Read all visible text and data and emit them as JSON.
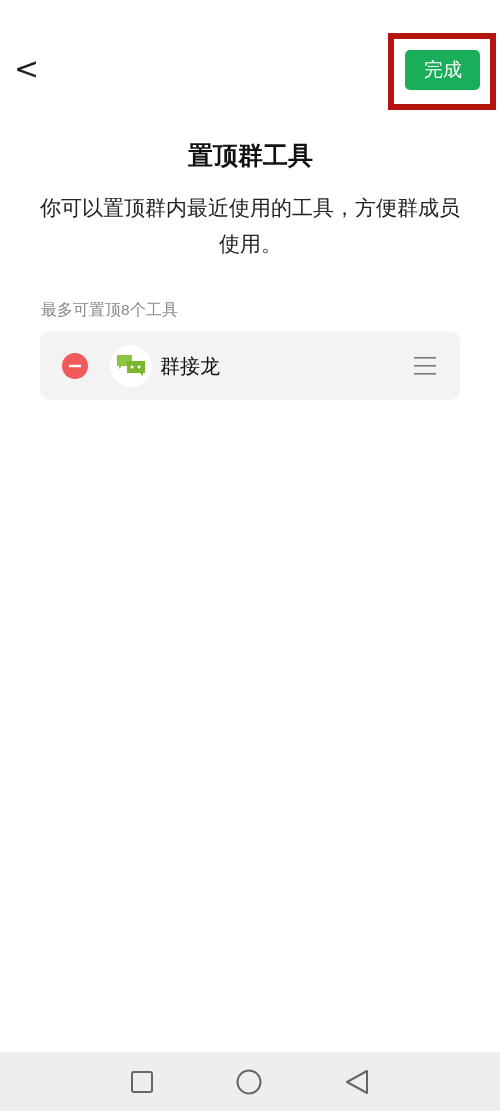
{
  "header": {
    "back": "<",
    "done_button": "完成"
  },
  "title": "置顶群工具",
  "description": "你可以置顶群内最近使用的工具，方便群成员使用。",
  "hint": "最多可置顶8个工具",
  "tools": [
    {
      "name": "群接龙"
    }
  ]
}
